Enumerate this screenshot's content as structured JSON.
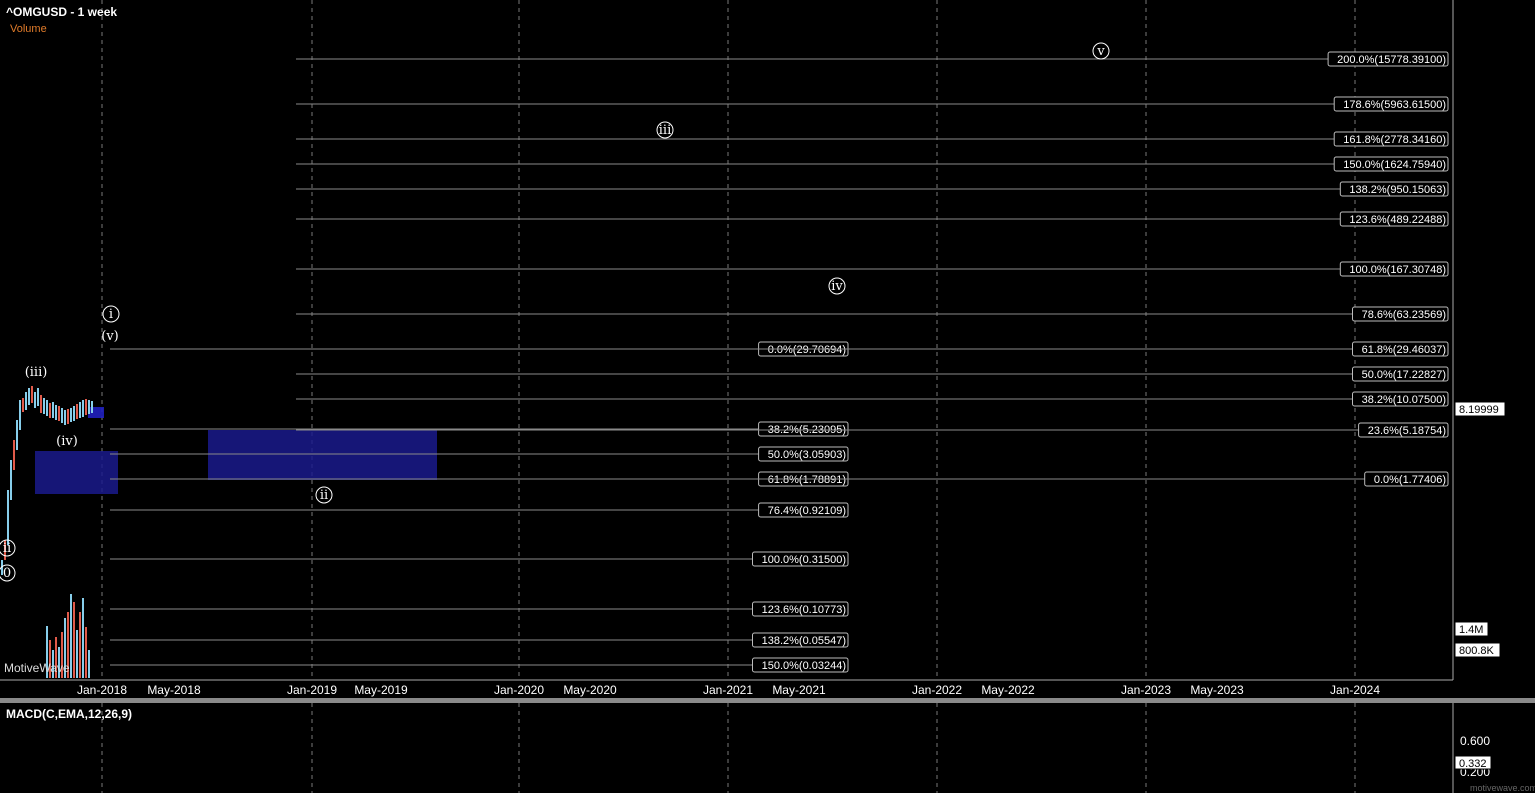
{
  "header": {
    "title": "^OMGUSD - 1 week",
    "volume_label": "Volume"
  },
  "watermark": "MotiveWave",
  "footer_watermark": "motivewave.com",
  "colors": {
    "background": "#000000",
    "grid": "#777777",
    "fib_line": "#8a8a8a",
    "zone": "#1a1a8c",
    "up_bar": "#87ceeb",
    "down_bar": "#e05a4a"
  },
  "chart_data": {
    "type": "line",
    "title": "^OMGUSD - 1 week",
    "x_axis": {
      "tick_labels": [
        "Jan-2018",
        "May-2018",
        "Jan-2019",
        "May-2019",
        "Jan-2020",
        "May-2020",
        "Jan-2021",
        "May-2021",
        "Jan-2022",
        "May-2022",
        "Jan-2023",
        "May-2023",
        "Jan-2024"
      ]
    },
    "y_axis": {
      "scale": "log",
      "price_tag": "8.19999",
      "volume_tags": [
        "1.4M",
        "800.8K"
      ]
    },
    "grid": "vertical dashed at each Jan",
    "fib_left": [
      {
        "label": "0.0%(29.70694)",
        "value": 29.70694
      },
      {
        "label": "38.2%(5.23095)",
        "value": 5.23095
      },
      {
        "label": "50.0%(3.05903)",
        "value": 3.05903
      },
      {
        "label": "61.8%(1.78891)",
        "value": 1.78891
      },
      {
        "label": "76.4%(0.92109)",
        "value": 0.92109
      },
      {
        "label": "100.0%(0.31500)",
        "value": 0.315
      },
      {
        "label": "123.6%(0.10773)",
        "value": 0.10773
      },
      {
        "label": "138.2%(0.05547)",
        "value": 0.05547
      },
      {
        "label": "150.0%(0.03244)",
        "value": 0.03244
      }
    ],
    "fib_right": [
      {
        "label": "200.0%(15778.39100)",
        "value": 15778.391
      },
      {
        "label": "178.6%(5963.61500)",
        "value": 5963.615
      },
      {
        "label": "161.8%(2778.34160)",
        "value": 2778.3416
      },
      {
        "label": "150.0%(1624.75940)",
        "value": 1624.7594
      },
      {
        "label": "138.2%(950.15063)",
        "value": 950.15063
      },
      {
        "label": "123.6%(489.22488)",
        "value": 489.22488
      },
      {
        "label": "100.0%(167.30748)",
        "value": 167.30748
      },
      {
        "label": "78.6%(63.23569)",
        "value": 63.23569
      },
      {
        "label": "61.8%(29.46037)",
        "value": 29.46037
      },
      {
        "label": "50.0%(17.22827)",
        "value": 17.22827
      },
      {
        "label": "38.2%(10.07500)",
        "value": 10.075
      },
      {
        "label": "23.6%(5.18754)",
        "value": 5.18754
      },
      {
        "label": "0.0%(1.77406)",
        "value": 1.77406
      }
    ],
    "wave_labels": [
      "i",
      "(v)",
      "(iii)",
      "(iv)",
      "ii",
      "iii",
      "iv",
      "v",
      "0",
      "ii"
    ]
  },
  "macd": {
    "label": "MACD(C,EMA,12,26,9)",
    "tick_labels": [
      "0.600",
      "0.200"
    ],
    "value_tag": "0.332"
  }
}
